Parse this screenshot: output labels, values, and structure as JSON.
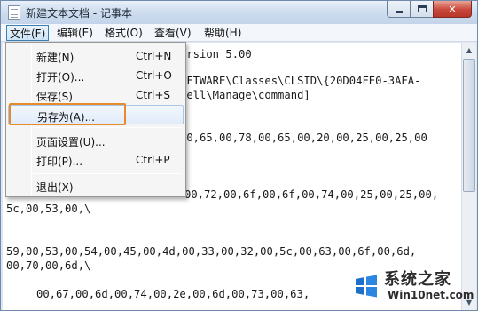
{
  "window": {
    "title": "新建文本文档 - 记事本"
  },
  "menubar": {
    "items": [
      {
        "label": "文件(F)"
      },
      {
        "label": "编辑(E)"
      },
      {
        "label": "格式(O)"
      },
      {
        "label": "查看(V)"
      },
      {
        "label": "帮助(H)"
      }
    ]
  },
  "file_menu": {
    "items": [
      {
        "label": "新建(N)",
        "shortcut": "Ctrl+N"
      },
      {
        "label": "打开(O)...",
        "shortcut": "Ctrl+O"
      },
      {
        "label": "保存(S)",
        "shortcut": "Ctrl+S"
      },
      {
        "label": "另存为(A)...",
        "shortcut": ""
      },
      {
        "label": "页面设置(U)...",
        "shortcut": ""
      },
      {
        "label": "打印(P)...",
        "shortcut": "Ctrl+P"
      },
      {
        "label": "退出(X)",
        "shortcut": ""
      }
    ]
  },
  "editor": {
    "lines": [
      "ersion 5.00",
      "OFTWARE\\Classes\\CLSID\\{20D04FE0-3AEA-",
      "hell\\Manage\\command]",
      "00,65,00,78,00,65,00,20,00,25,00,25,00",
      "00,72,00,6f,00,6f,00,74,00,25,00,25,00,",
      "5c,00,53,00,\\",
      "59,00,53,00,54,00,45,00,4d,00,33,00,32,00,5c,00,63,00,6f,00,6d,",
      "00,70,00,6d,\\",
      "00,67,00,6d,00,74,00,2e,00,6d,00,73,00,63,"
    ]
  },
  "watermark": {
    "title": "系统之家",
    "subtitle": "Win10net.com"
  },
  "colors": {
    "highlight_border": "#e88a2c",
    "menu_active_border": "#3c7fb1",
    "close_button": "#c8473a"
  },
  "icons": {
    "app": "notepad-icon",
    "minimize": "minimize-icon",
    "maximize": "maximize-icon",
    "close": "close-icon",
    "watermark": "windows-logo-icon"
  }
}
